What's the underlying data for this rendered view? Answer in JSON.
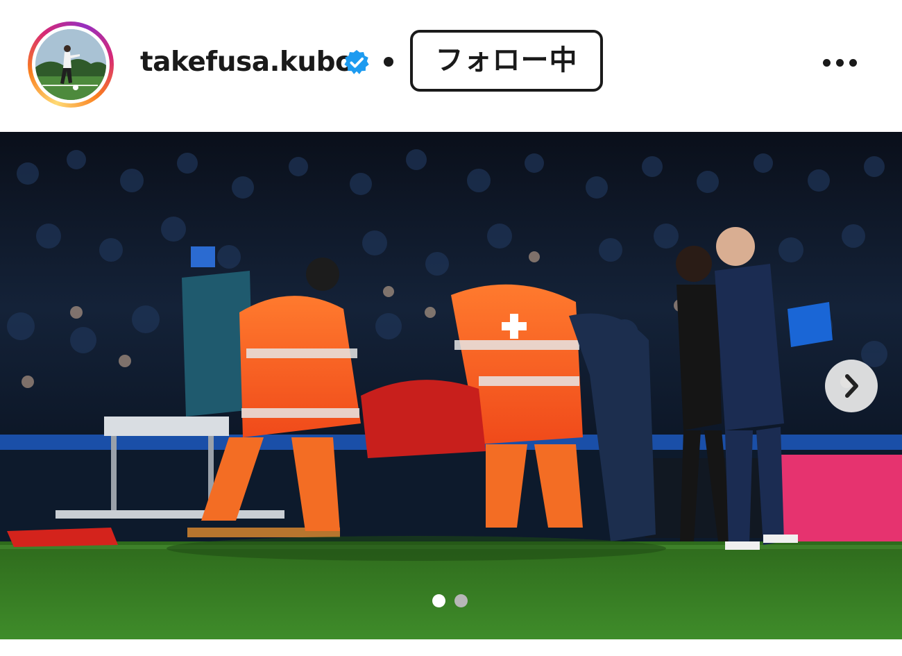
{
  "post_header": {
    "username": "takefusa.kubo",
    "verified_icon": "verified-badge-icon",
    "separator": "•",
    "follow_label": "フォロー中",
    "more_icon": "more-options-icon"
  },
  "carousel": {
    "current_index": 1,
    "total": 2,
    "next_icon": "chevron-right-icon"
  },
  "colors": {
    "verified_blue": "#1d9bf0",
    "text_dark": "#1a1a1a",
    "pager_active": "#ffffff",
    "pager_inactive": "#b7b7b7"
  }
}
